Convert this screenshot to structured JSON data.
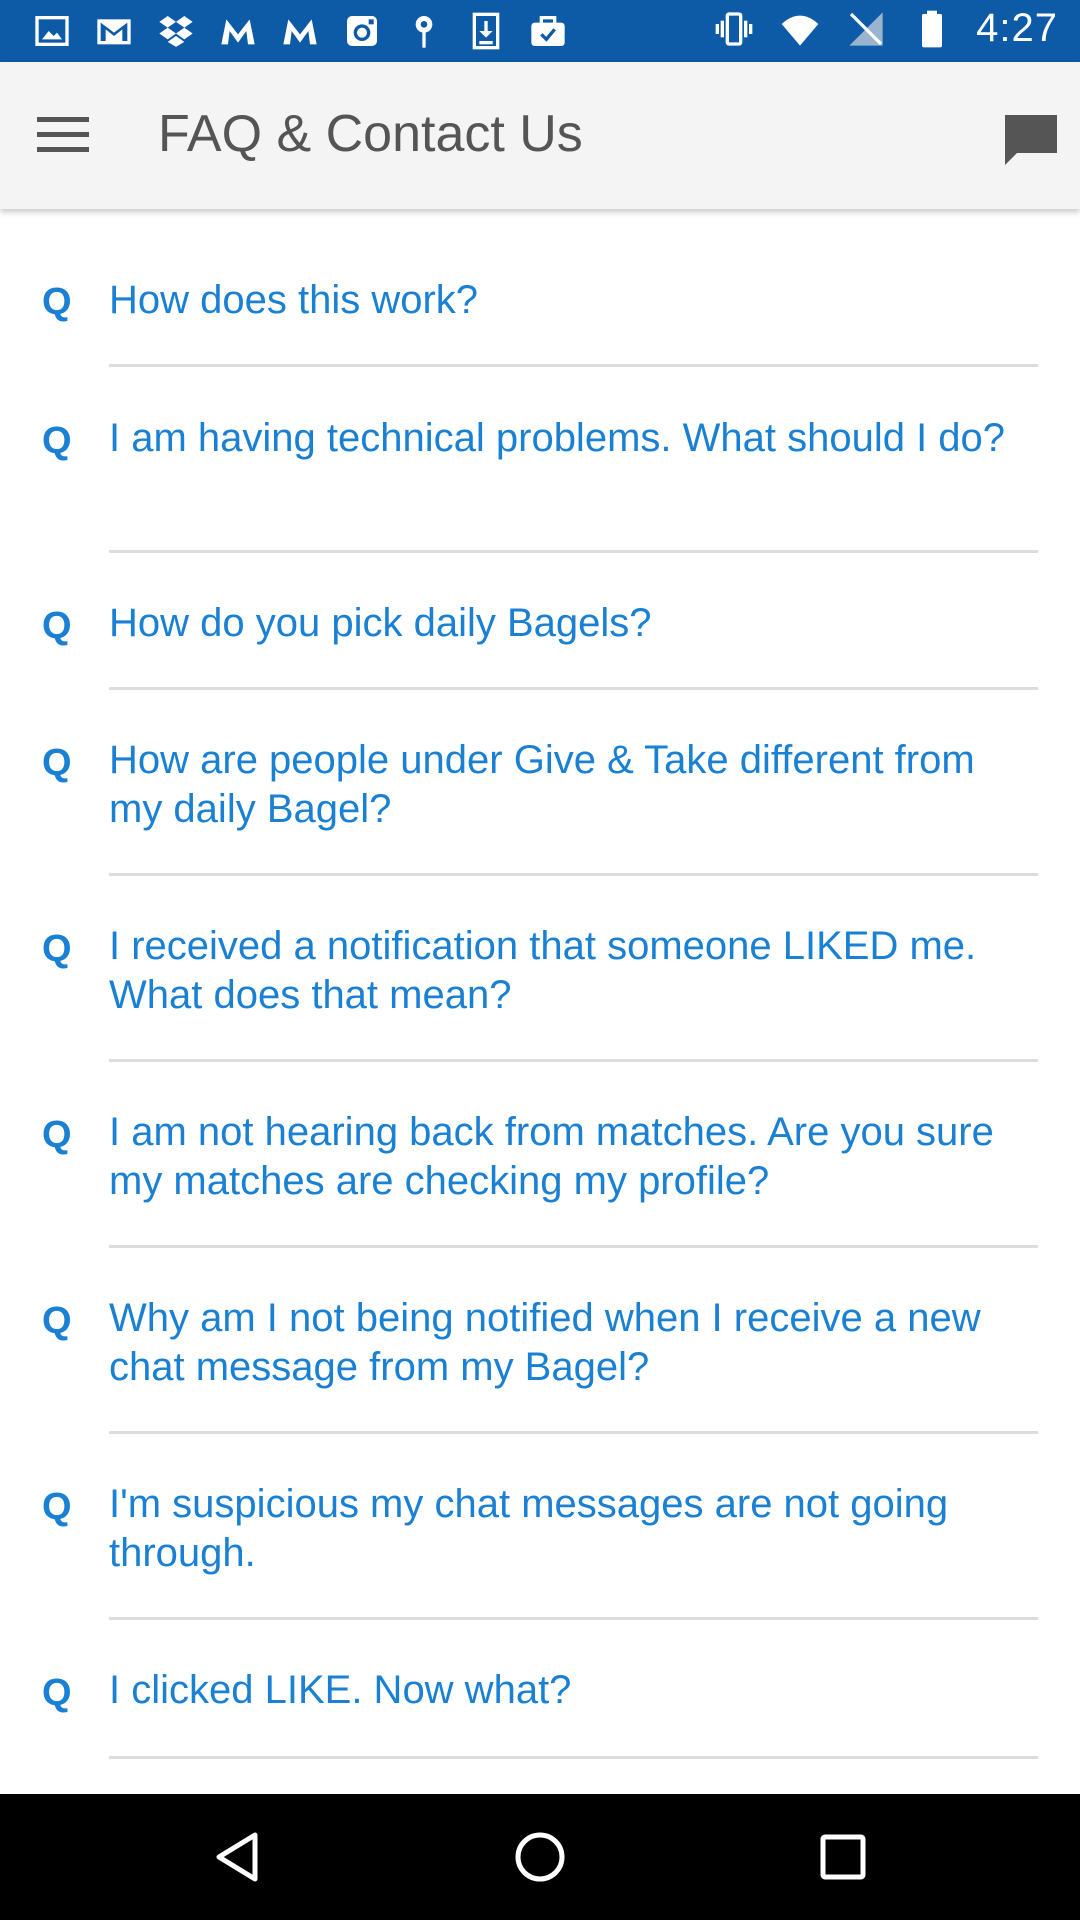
{
  "status_bar": {
    "time": "4:27",
    "left_icons": [
      "gallery-icon",
      "gmail-icon",
      "dropbox-icon",
      "motorola-icon",
      "motorola-icon",
      "instagram-icon",
      "location-pin-icon",
      "download-icon",
      "briefcase-icon"
    ],
    "right_icons": [
      "vibrate-icon",
      "wifi-icon",
      "no-signal-icon",
      "battery-icon"
    ],
    "background": "#0d5aa7"
  },
  "app_bar": {
    "title": "FAQ & Contact Us",
    "menu_icon": "hamburger-menu-icon",
    "action_icon": "chat-icon"
  },
  "faq": {
    "marker": "Q",
    "accent_color": "#1a80d4",
    "items": [
      "How does this work?",
      "I am having technical problems. What should I do?",
      "How do you pick daily Bagels?",
      "How are people under Give & Take different from my daily Bagel?",
      "I received a notification that someone LIKED me. What does that mean?",
      "I am not hearing back from matches. Are you sure my matches are checking my profile?",
      "Why am I not being notified when I receive a new chat message from my Bagel?",
      "I'm suspicious my chat messages are not going through.",
      "I clicked LIKE. Now what?"
    ]
  },
  "nav_bar": {
    "buttons": [
      "back-icon",
      "home-icon",
      "recents-icon"
    ]
  }
}
